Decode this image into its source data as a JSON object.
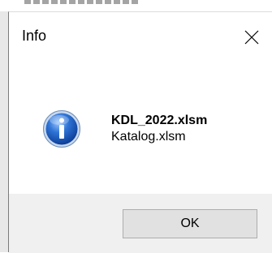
{
  "dialog": {
    "title": "Info",
    "close_icon": "close-icon",
    "icon": "info-icon",
    "message_lines": [
      "KDL_2022.xlsm",
      "Katalog.xlsm"
    ],
    "ok_label": "OK"
  },
  "colors": {
    "footer_bg": "#f0f0f0",
    "button_bg": "#e1e1e1",
    "button_border": "#adadad",
    "icon_blue": "#1f5fbf"
  }
}
